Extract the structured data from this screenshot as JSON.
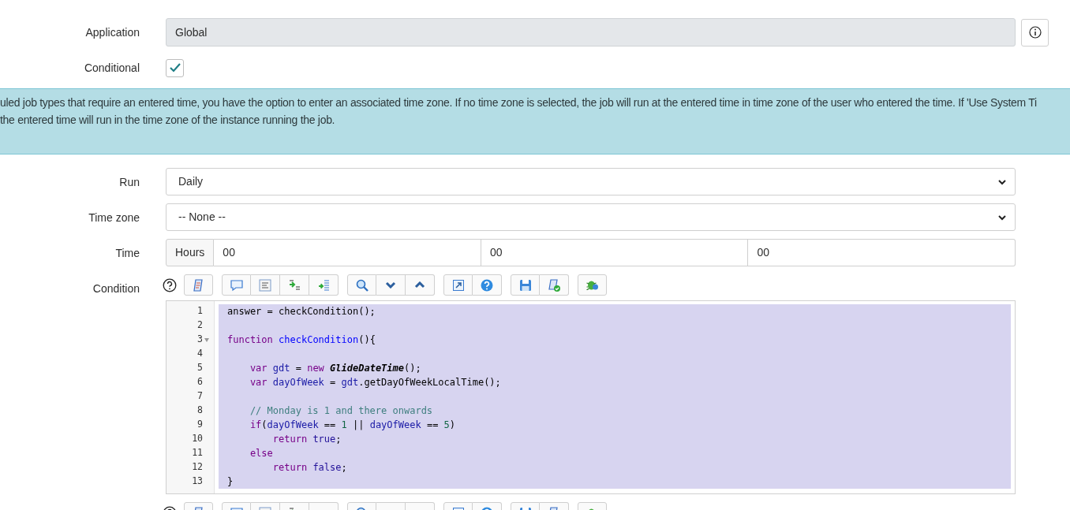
{
  "application": {
    "label": "Application",
    "value": "Global"
  },
  "conditional": {
    "label": "Conditional",
    "checked": true
  },
  "info_banner": {
    "lines": [
      "uled job types that require an entered time, you have the option to enter an associated time zone. If no time zone is selected, the job will run at the entered time in time zone of the user who entered the time. If 'Use System Ti",
      "the entered time will run in the time zone of the instance running the job."
    ]
  },
  "run": {
    "label": "Run",
    "value": "Daily"
  },
  "time_zone": {
    "label": "Time zone",
    "value": "-- None --"
  },
  "time": {
    "label": "Time",
    "unit": "Hours",
    "values": [
      "00",
      "00",
      "00"
    ]
  },
  "condition": {
    "label": "Condition",
    "code": [
      {
        "number": "1",
        "foldable": false,
        "tokens": [
          {
            "kind": "plain",
            "text": "answer = checkCondition();"
          }
        ]
      },
      {
        "number": "2",
        "foldable": false
      },
      {
        "number": "3",
        "foldable": true,
        "tokens": [
          {
            "kind": "keyword",
            "text": "function "
          },
          {
            "kind": "def",
            "text": "checkCondition"
          },
          {
            "kind": "plain",
            "text": "(){"
          }
        ]
      },
      {
        "number": "4",
        "foldable": false
      },
      {
        "number": "5",
        "foldable": false,
        "tokens": [
          {
            "kind": "keyword",
            "text": "    var "
          },
          {
            "kind": "variable",
            "text": "gdt"
          },
          {
            "kind": "plain",
            "text": " = "
          },
          {
            "kind": "keyword",
            "text": "new "
          },
          {
            "kind": "class",
            "text": "GlideDateTime"
          },
          {
            "kind": "plain",
            "text": "();"
          }
        ]
      },
      {
        "number": "6",
        "foldable": false,
        "tokens": [
          {
            "kind": "keyword",
            "text": "    var "
          },
          {
            "kind": "variable",
            "text": "dayOfWeek"
          },
          {
            "kind": "plain",
            "text": " = "
          },
          {
            "kind": "variable",
            "text": "gdt"
          },
          {
            "kind": "plain",
            "text": ".getDayOfWeekLocalTime();"
          }
        ]
      },
      {
        "number": "7",
        "foldable": false
      },
      {
        "number": "8",
        "foldable": false,
        "tokens": [
          {
            "kind": "comment",
            "text": "    // Monday is 1 and there onwards"
          }
        ]
      },
      {
        "number": "9",
        "foldable": false,
        "tokens": [
          {
            "kind": "keyword",
            "text": "    if"
          },
          {
            "kind": "plain",
            "text": "("
          },
          {
            "kind": "variable",
            "text": "dayOfWeek"
          },
          {
            "kind": "plain",
            "text": " == "
          },
          {
            "kind": "number",
            "text": "1"
          },
          {
            "kind": "plain",
            "text": " || "
          },
          {
            "kind": "variable",
            "text": "dayOfWeek"
          },
          {
            "kind": "plain",
            "text": " == "
          },
          {
            "kind": "number",
            "text": "5"
          },
          {
            "kind": "plain",
            "text": ")"
          }
        ]
      },
      {
        "number": "10",
        "foldable": false,
        "tokens": [
          {
            "kind": "keyword",
            "text": "        return "
          },
          {
            "kind": "atom",
            "text": "true"
          },
          {
            "kind": "plain",
            "text": ";"
          }
        ]
      },
      {
        "number": "11",
        "foldable": false,
        "tokens": [
          {
            "kind": "keyword",
            "text": "    else"
          }
        ]
      },
      {
        "number": "12",
        "foldable": false,
        "tokens": [
          {
            "kind": "keyword",
            "text": "        return "
          },
          {
            "kind": "atom",
            "text": "false"
          },
          {
            "kind": "plain",
            "text": ";"
          }
        ]
      },
      {
        "number": "13",
        "foldable": false,
        "tokens": [
          {
            "kind": "plain",
            "text": "}"
          }
        ]
      }
    ]
  }
}
